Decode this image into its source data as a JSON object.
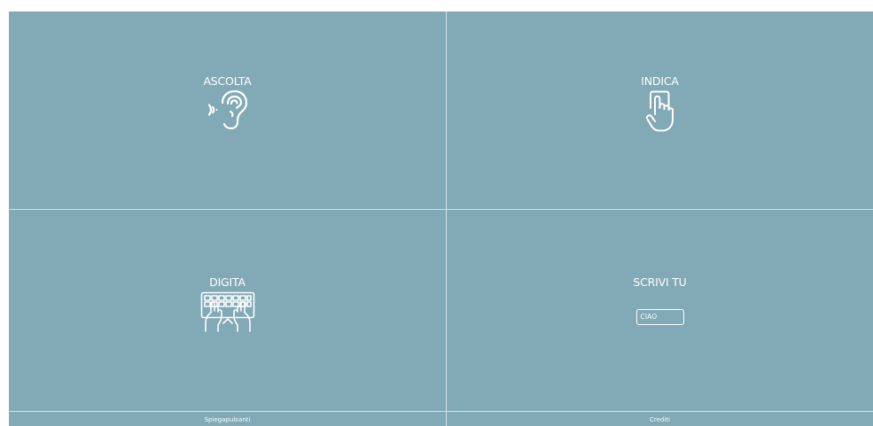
{
  "tiles": {
    "listen": {
      "label": "ASCOLTA",
      "icon": "ear-sound-icon"
    },
    "point": {
      "label": "INDICA",
      "icon": "finger-tap-icon"
    },
    "type": {
      "label": "DIGITA",
      "icon": "keyboard-hands-icon"
    },
    "write": {
      "label": "SCRIVI TU",
      "icon": "text-field-icon",
      "sample_text": "CIAO"
    }
  },
  "footer": {
    "left_link": "Spiegapulsanti",
    "right_link": "Crediti"
  },
  "colors": {
    "background": "#81a9b6",
    "divider": "#d4e3e8",
    "foreground": "#ffffff"
  }
}
